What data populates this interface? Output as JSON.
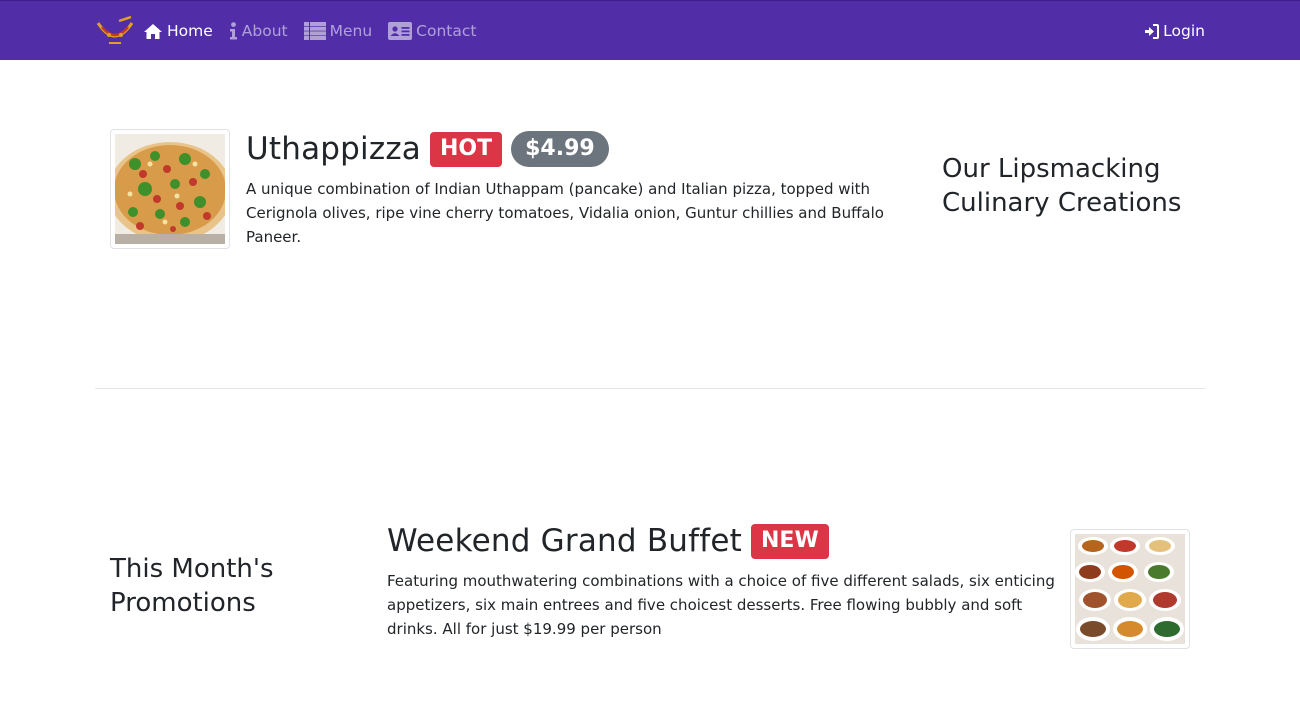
{
  "nav": {
    "items": [
      {
        "label": "Home",
        "icon": "home-icon",
        "active": true
      },
      {
        "label": "About",
        "icon": "info-icon",
        "active": false
      },
      {
        "label": "Menu",
        "icon": "list-icon",
        "active": false
      },
      {
        "label": "Contact",
        "icon": "address-card-icon",
        "active": false
      }
    ],
    "login_label": "Login",
    "background": "#512da8"
  },
  "featured_dish": {
    "name": "Uthappizza",
    "badge": "HOT",
    "price": "$4.99",
    "description": "A unique combination of Indian Uthappam (pancake) and Italian pizza, topped with Cerignola olives, ripe vine cherry tomatoes, Vidalia onion, Guntur chillies and Buffalo Paneer.",
    "side_heading": "Our Lipsmacking Culinary Creations"
  },
  "promotion": {
    "side_heading": "This Month's Promotions",
    "name": "Weekend Grand Buffet",
    "badge": "NEW",
    "description": "Featuring mouthwatering combinations with a choice of five different salads, six enticing appetizers, six main entrees and five choicest desserts. Free flowing bubbly and soft drinks. All for just $19.99 per person"
  },
  "colors": {
    "badge_danger": "#dc3545",
    "badge_secondary": "#6c757d"
  }
}
